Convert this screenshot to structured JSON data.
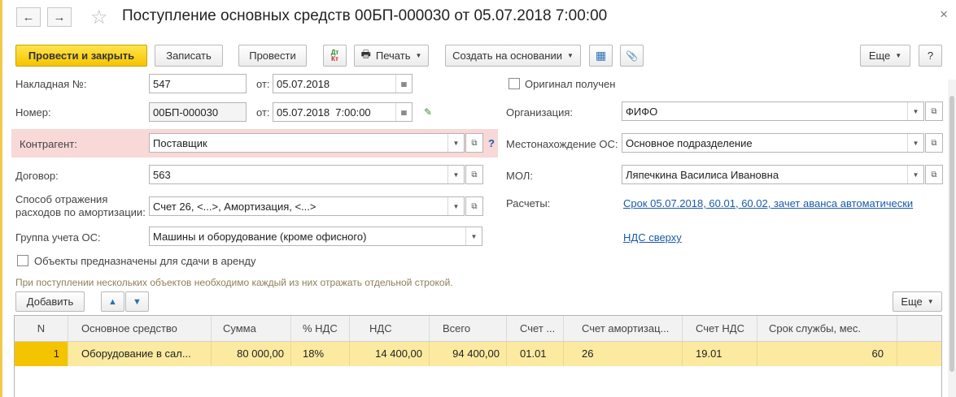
{
  "title": "Поступление основных средств 00БП-000030 от 05.07.2018 7:00:00",
  "icons": {
    "back": "←",
    "forward": "→",
    "star": "☆",
    "close": "×",
    "dtkt_top": "Дт",
    "dtkt_bottom": "Кт",
    "print": "🖶",
    "structure": "▦",
    "attach": "📎",
    "up": "▲",
    "down": "▼",
    "calendar": "▦",
    "dropdown": "▼",
    "open": "⧉",
    "edit": "✎"
  },
  "toolbar": {
    "post_close": "Провести и закрыть",
    "save": "Записать",
    "post": "Провести",
    "print": "Печать",
    "create_based": "Создать на основании",
    "more": "Еще",
    "help": "?"
  },
  "form": {
    "invoice_label": "Накладная №:",
    "invoice_value": "547",
    "from_label": "от:",
    "invoice_date": "05.07.2018",
    "number_label": "Номер:",
    "number_value": "00БП-000030",
    "number_date": "05.07.2018  7:00:00",
    "counterparty_label": "Контрагент:",
    "counterparty_value": "Поставщик",
    "question": "?",
    "contract_label": "Договор:",
    "contract_value": "563",
    "amort_label_1": "Способ отражения",
    "amort_label_2": "расходов по амортизации:",
    "amort_value": "Счет 26, <...>, Амортизация, <...>",
    "group_label": "Группа учета ОС:",
    "group_value": "Машины и оборудование (кроме офисного)",
    "rent_checkbox": "Объекты предназначены для сдачи в аренду",
    "hint": "При поступлении нескольких объектов необходимо каждый из них отражать отдельной строкой.",
    "original_checkbox": "Оригинал получен",
    "org_label": "Организация:",
    "org_value": "ФИФО",
    "location_label": "Местонахождение ОС:",
    "location_value": "Основное подразделение",
    "mol_label": "МОЛ:",
    "mol_value": "Ляпечкина Василиса Ивановна",
    "settlements_label": "Расчеты:",
    "settlements_link": "Срок 05.07.2018, 60.01, 60.02, зачет аванса автоматически",
    "vat_link": "НДС сверху"
  },
  "table_toolbar": {
    "add": "Добавить",
    "more": "Еще"
  },
  "table": {
    "columns": [
      "N",
      "Основное средство",
      "Сумма",
      "% НДС",
      "НДС",
      "Всего",
      "Счет ...",
      "Счет амортизац...",
      "Счет НДС",
      "Срок службы, мес."
    ],
    "rows": [
      [
        "1",
        "Оборудование в сал...",
        "80 000,00",
        "18%",
        "14 400,00",
        "94 400,00",
        "01.01",
        "26",
        "19.01",
        "60"
      ]
    ]
  }
}
